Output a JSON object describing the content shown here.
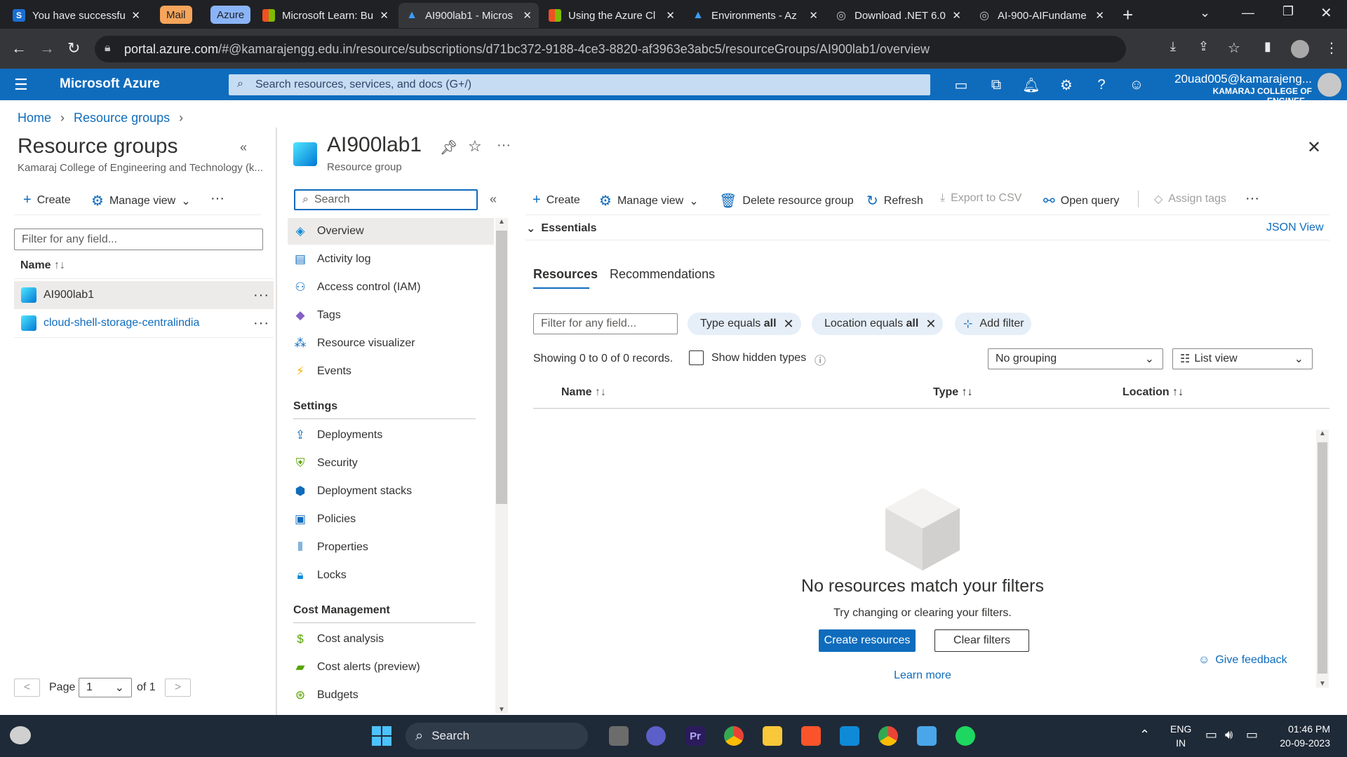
{
  "browser": {
    "tabs": [
      {
        "title": "You have successfu",
        "icon": "s-icon"
      },
      {
        "title": "Microsoft Learn: Bu",
        "icon": "microsoft-icon"
      },
      {
        "title": "AI900lab1 - Micros",
        "icon": "azure-icon"
      },
      {
        "title": "Using the Azure Cl",
        "icon": "microsoft-icon"
      },
      {
        "title": "Environments - Az",
        "icon": "azure-icon"
      },
      {
        "title": "Download .NET 6.0",
        "icon": "globe-icon"
      },
      {
        "title": "AI-900-AIFundame",
        "icon": "globe-icon"
      }
    ],
    "group_pills": [
      "Mail",
      "Azure"
    ],
    "url_host": "portal.azure.com",
    "url_path": "/#@kamarajengg.edu.in/resource/subscriptions/d71bc372-9188-4ce3-8820-af3963e3abc5/resourceGroups/AI900lab1/overview"
  },
  "portal": {
    "brand": "Microsoft Azure",
    "search_placeholder": "Search resources, services, and docs (G+/)",
    "account_user": "20uad005@kamarajeng...",
    "account_org": "KAMARAJ COLLEGE OF ENGINEE..."
  },
  "breadcrumb": [
    "Home",
    "Resource groups"
  ],
  "left_pane": {
    "title": "Resource groups",
    "subtitle": "Kamaraj College of Engineering and Technology (k...",
    "create": "Create",
    "manage_view": "Manage view",
    "filter_placeholder": "Filter for any field...",
    "name_header": "Name",
    "items": [
      "AI900lab1",
      "cloud-shell-storage-centralindia"
    ],
    "page_label": "Page",
    "page_value": "1",
    "of_label": "of 1"
  },
  "resource": {
    "title": "AI900lab1",
    "subtitle": "Resource group",
    "search_placeholder": "Search",
    "menu": [
      {
        "label": "Overview",
        "icon": "cube-icon"
      },
      {
        "label": "Activity log",
        "icon": "log-icon"
      },
      {
        "label": "Access control (IAM)",
        "icon": "people-icon"
      },
      {
        "label": "Tags",
        "icon": "tag-icon"
      },
      {
        "label": "Resource visualizer",
        "icon": "visualizer-icon"
      },
      {
        "label": "Events",
        "icon": "bolt-icon"
      }
    ],
    "settings_header": "Settings",
    "settings": [
      {
        "label": "Deployments",
        "icon": "upload-icon"
      },
      {
        "label": "Security",
        "icon": "shield-icon"
      },
      {
        "label": "Deployment stacks",
        "icon": "stack-icon"
      },
      {
        "label": "Policies",
        "icon": "policy-icon"
      },
      {
        "label": "Properties",
        "icon": "properties-icon"
      },
      {
        "label": "Locks",
        "icon": "lock-icon"
      }
    ],
    "cost_header": "Cost Management",
    "cost": [
      {
        "label": "Cost analysis",
        "icon": "cost-icon"
      },
      {
        "label": "Cost alerts (preview)",
        "icon": "alert-icon"
      },
      {
        "label": "Budgets",
        "icon": "budget-icon"
      }
    ]
  },
  "toolbar": {
    "create": "Create",
    "manage_view": "Manage view",
    "delete": "Delete resource group",
    "refresh": "Refresh",
    "export": "Export to CSV",
    "open_query": "Open query",
    "assign_tags": "Assign tags"
  },
  "essentials": {
    "label": "Essentials",
    "json_view": "JSON View"
  },
  "tabs": [
    "Resources",
    "Recommendations"
  ],
  "filters": {
    "placeholder": "Filter for any field...",
    "type_prefix": "Type equals ",
    "type_value": "all",
    "location_prefix": "Location equals ",
    "location_value": "all",
    "add_filter": "Add filter"
  },
  "records": {
    "showing": "Showing 0 to 0 of 0 records.",
    "show_hidden": "Show hidden types",
    "grouping": "No grouping",
    "view": "List view"
  },
  "columns": [
    "Name",
    "Type",
    "Location"
  ],
  "empty": {
    "title": "No resources match your filters",
    "subtitle": "Try changing or clearing your filters.",
    "create": "Create resources",
    "clear": "Clear filters",
    "learn_more": "Learn more",
    "feedback": "Give feedback"
  },
  "taskbar": {
    "search": "Search",
    "lang1": "ENG",
    "lang2": "IN",
    "time": "01:46 PM",
    "date": "20-09-2023"
  }
}
